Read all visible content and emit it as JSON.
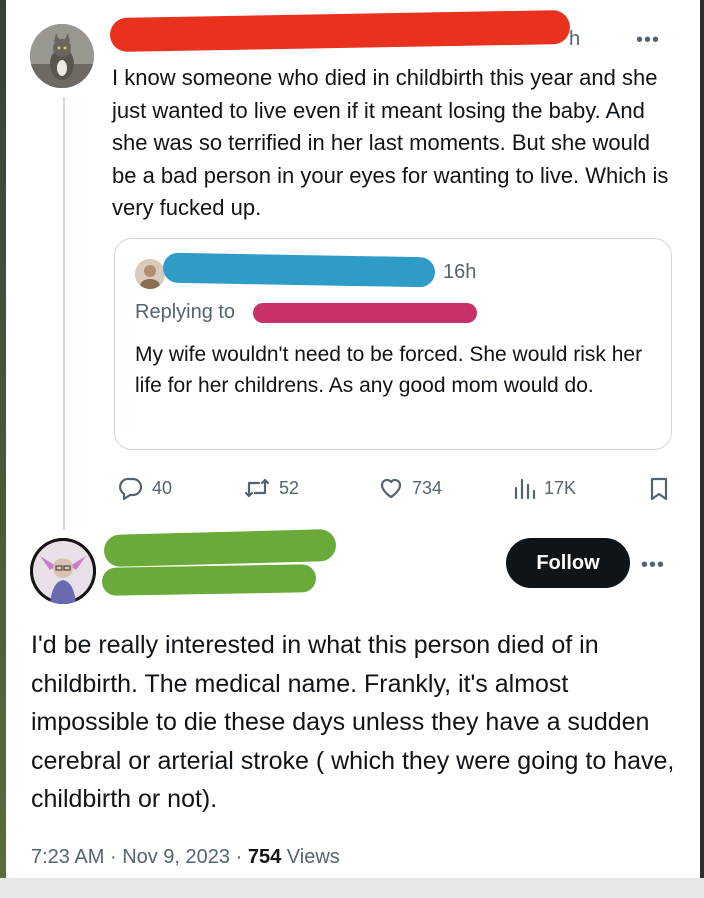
{
  "tweet1": {
    "time_partial": "h",
    "body": "I know someone who died in childbirth this year and she just wanted to live even if it meant losing the baby. And she was so terrified in her last moments. But she would be a bad person in your eyes for wanting to live. Which is very fucked up.",
    "quoted": {
      "time": "16h",
      "replying_to": "Replying to",
      "body": "My wife wouldn't need to be forced. She would risk her life for her childrens. As any good mom would do."
    },
    "actions": {
      "replies": "40",
      "reposts": "52",
      "likes": "734",
      "views": "17K"
    }
  },
  "tweet2": {
    "follow_label": "Follow",
    "body": "I'd be really interested in what this person died of in childbirth. The medical name. Frankly, it's almost impossible to die these days unless they have a sudden cerebral or arterial stroke ( which they were going to have, childbirth or not).",
    "meta": {
      "time": "7:23 AM",
      "sep1": "·",
      "date": "Nov 9, 2023",
      "sep2": "·",
      "views_count": "754",
      "views_label": "Views"
    }
  },
  "more_glyph": "•••",
  "colors": {
    "redact_red": "#e8321e",
    "redact_blue": "#2f9cc8",
    "redact_pink": "#c8306a",
    "redact_green": "#6aaa3a",
    "text": "#0f1419",
    "secondary": "#536471",
    "border": "#cfd9de"
  },
  "icons": [
    "reply-icon",
    "repost-icon",
    "like-icon",
    "views-icon",
    "bookmark-icon",
    "more-icon"
  ]
}
